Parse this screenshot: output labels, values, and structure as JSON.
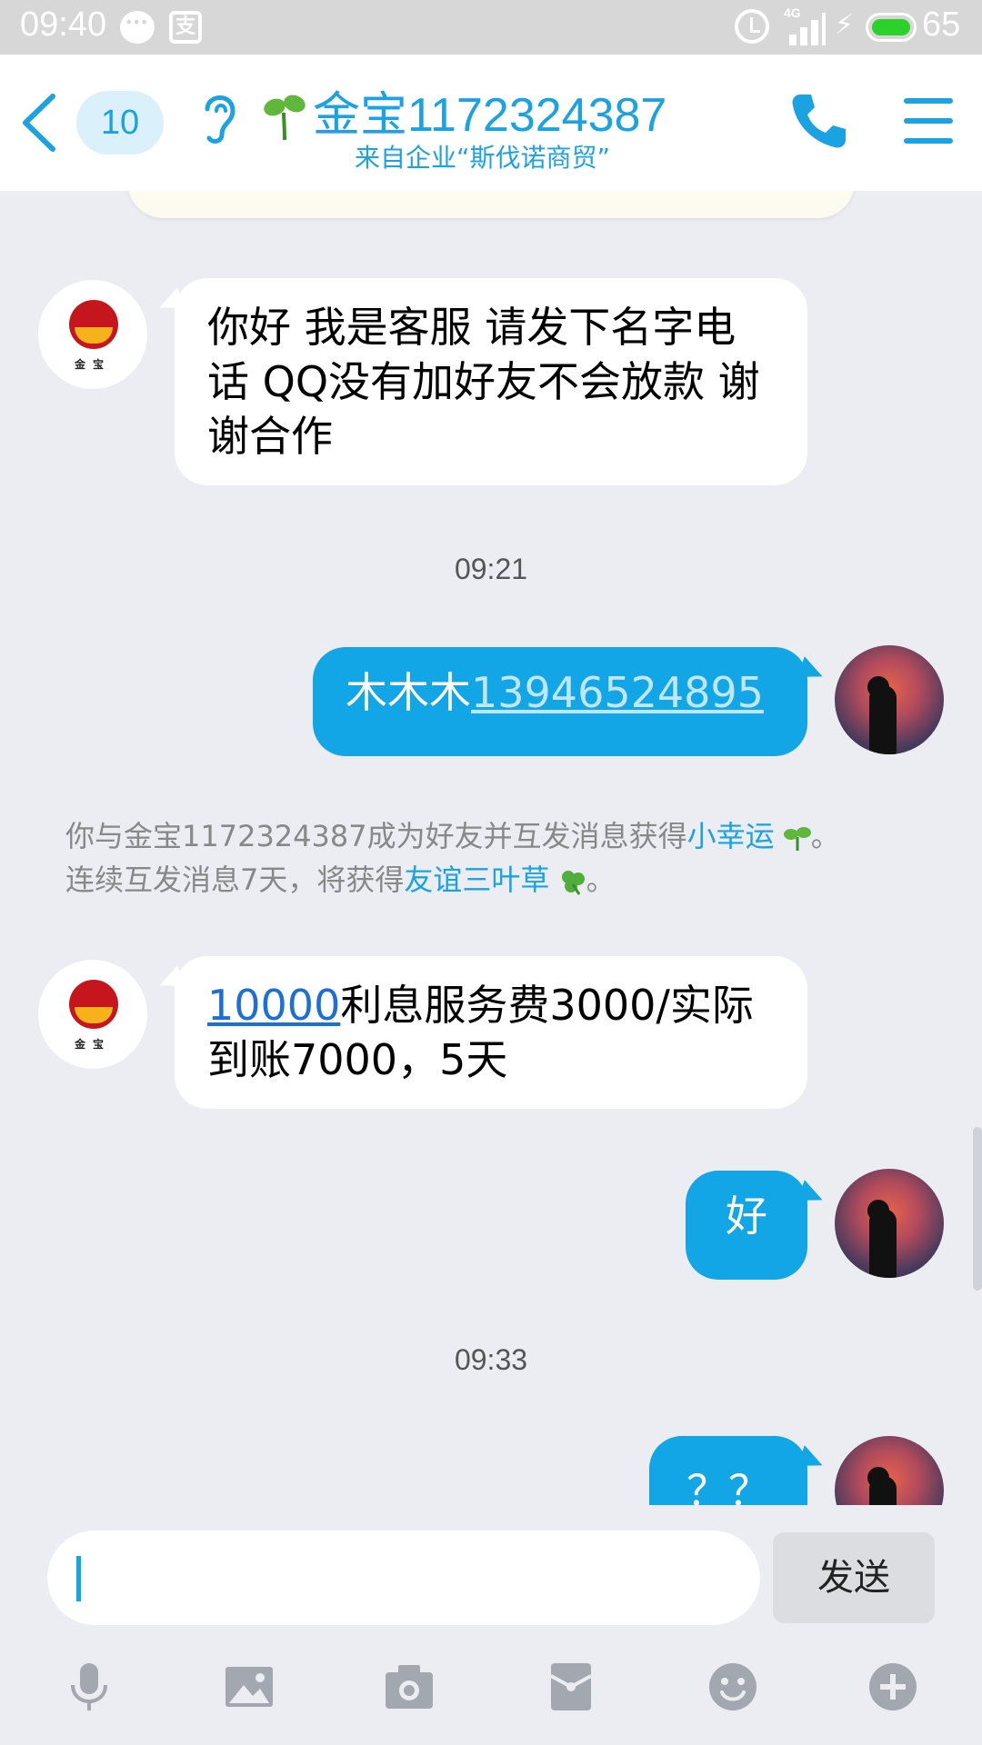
{
  "status_bar": {
    "time": "09:40",
    "network": "4G",
    "battery": "65"
  },
  "header": {
    "unread_count": "10",
    "contact_name": "金宝1172324387",
    "contact_subtitle": "来自企业“斯伐诺商贸”"
  },
  "messages": [
    {
      "side": "left",
      "text": "你好 我是客服  请发下名字电话   QQ没有加好友不会放款  谢谢合作"
    },
    {
      "type": "time",
      "text": "09:21"
    },
    {
      "side": "right",
      "name": "木木木",
      "phone": "13946524895"
    },
    {
      "type": "system",
      "line1_pre": "你与金宝1172324387成为好友并互发消息获得",
      "line1_link": "小幸运",
      "line1_end": "。",
      "line2_pre": "连续互发消息7天，将获得",
      "line2_link": "友谊三叶草",
      "line2_end": "。"
    },
    {
      "side": "left",
      "amount": "10000",
      "text": "利息服务费3000/实际到账7000，5天"
    },
    {
      "side": "right",
      "text": "好"
    },
    {
      "type": "time",
      "text": "09:33"
    },
    {
      "side": "right",
      "text": "？？"
    }
  ],
  "avatar_logo_text": "金宝",
  "input": {
    "placeholder": "",
    "send_label": "发送"
  },
  "toolbar": [
    "mic-icon",
    "image-icon",
    "camera-icon",
    "red-packet-icon",
    "emoji-icon",
    "plus-icon"
  ],
  "colors": {
    "accent": "#1ba2e3",
    "bubble_out": "#12a6e6",
    "background": "#ebedf2"
  }
}
